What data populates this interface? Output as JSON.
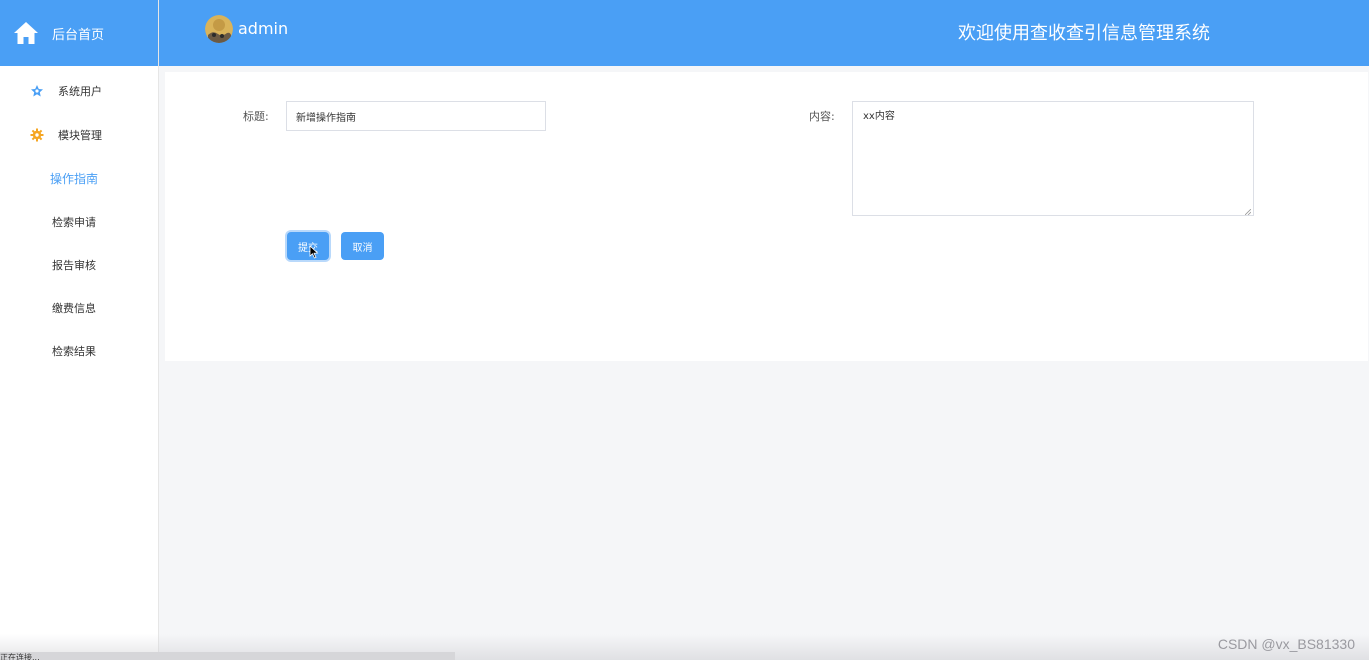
{
  "sidebar": {
    "logo_text": "后台首页",
    "menu": [
      {
        "label": "系统用户",
        "icon": "star-icon"
      },
      {
        "label": "模块管理",
        "icon": "gear-icon"
      }
    ],
    "submenu": [
      {
        "label": "操作指南",
        "active": true
      },
      {
        "label": "检索申请",
        "active": false
      },
      {
        "label": "报告审核",
        "active": false
      },
      {
        "label": "缴费信息",
        "active": false
      },
      {
        "label": "检索结果",
        "active": false
      }
    ]
  },
  "header": {
    "username": "admin",
    "system_title": "欢迎使用查收查引信息管理系统"
  },
  "form": {
    "title_label": "标题:",
    "title_value": "新增操作指南",
    "content_label": "内容:",
    "content_value": "xx内容",
    "submit_label": "提交",
    "cancel_label": "取消"
  },
  "status_bar": {
    "text": "正在连接..."
  },
  "watermark": "CSDN @vx_BS81330",
  "colors": {
    "primary": "#4a9ff5",
    "menu_icon_star": "#4a9ff5",
    "menu_icon_gear": "#f5a623"
  }
}
